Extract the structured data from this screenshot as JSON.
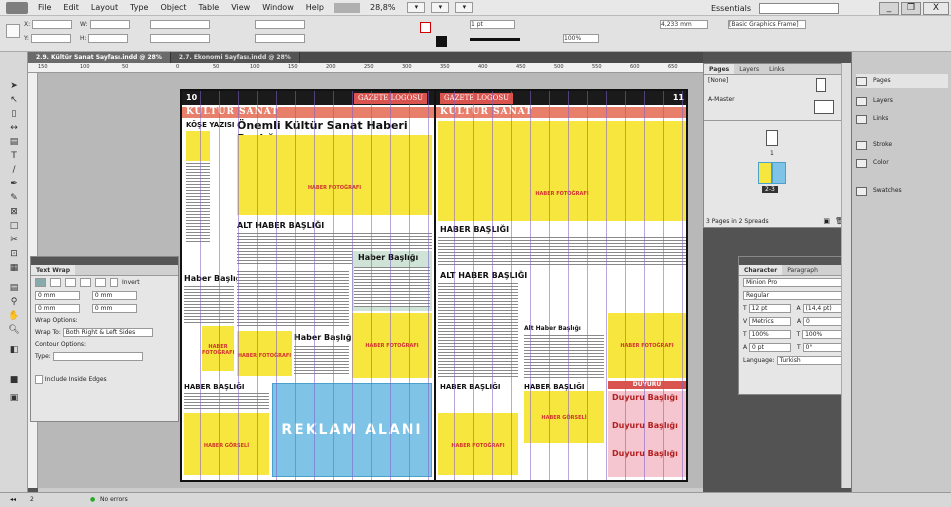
{
  "menu": {
    "items": [
      "File",
      "Edit",
      "Layout",
      "Type",
      "Object",
      "Table",
      "View",
      "Window",
      "Help"
    ],
    "zoom": "28,8%",
    "essentials": "Essentials",
    "window_controls": {
      "min": "_",
      "max": "❐",
      "close": "X"
    }
  },
  "control_bar": {
    "x_label": "X:",
    "y_label": "Y:",
    "w_label": "W:",
    "h_label": "H:",
    "stroke_weight": "1 pt",
    "percent": "100%",
    "measure": "4,233 mm",
    "frame_style": "[Basic Graphics Frame]"
  },
  "doc_tabs": [
    {
      "label": "2.9. Kültür Sanat Sayfası.indd @ 28%",
      "active": true
    },
    {
      "label": "2.7. Ekonomi Sayfası.indd @ 28%",
      "active": false
    }
  ],
  "ruler_ticks": [
    "150",
    "100",
    "50",
    "0",
    "50",
    "100",
    "150",
    "200",
    "250",
    "300",
    "350",
    "400",
    "450",
    "500",
    "550",
    "600",
    "650"
  ],
  "layout": {
    "page_left": {
      "number": "10",
      "logo": "GAZETE LOGOSU",
      "section": "KÜLTÜR SANAT",
      "column_label": "KÖŞE YAZISI",
      "main_headline": "Önemli Kültür Sanat Haberi Başlığı",
      "photo1": "HABER FOTOĞRAFI",
      "sub_headline": "ALT HABER BAŞLIĞI",
      "side_headline": "Haber Başlığı",
      "box_headline": "Haber Başlığı",
      "photo2": "HABER FOTOĞRAFI",
      "haber_headline": "Haber Başlığı",
      "photo3": "HABER FOTOĞRAFI",
      "small_headline": "HABER BAŞLIĞI",
      "gorsel": "HABER GÖRSELİ",
      "ad": "REKLAM ALANI",
      "foto_small": "HABER FOTOĞRAFI"
    },
    "page_right": {
      "number": "11",
      "logo": "GAZETE LOGOSU",
      "section": "KÜLTÜR SANAT",
      "photo1": "HABER FOTOĞRAFI",
      "headline1": "HABER BAŞLIĞI",
      "headline2": "ALT HABER BAŞLIĞI",
      "mid_headline": "Alt Haber Başlığı",
      "photo2": "HABER FOTOĞRAFI",
      "headline3": "HABER BAŞLIĞI",
      "headline4": "HABER BAŞLIĞI",
      "gorsel": "HABER GÖRSELİ",
      "photo3": "HABER FOTOĞRAFI",
      "duyuru_header": "DUYURU",
      "duyuru": [
        "Duyuru Başlığı",
        "Duyuru Başlığı",
        "Duyuru Başlığı"
      ]
    }
  },
  "text_wrap_panel": {
    "title": "Text Wrap",
    "invert": "Invert",
    "top": "0 mm",
    "bottom": "0 mm",
    "left": "0 mm",
    "right": "0 mm",
    "wrap_options": "Wrap Options:",
    "wrap_to_label": "Wrap To:",
    "wrap_to": "Both Right & Left Sides",
    "contour_options": "Contour Options:",
    "type_label": "Type:",
    "include_inside": "Include Inside Edges"
  },
  "pages_panel": {
    "tabs": [
      "Pages",
      "Layers",
      "Links"
    ],
    "none": "[None]",
    "master": "A-Master",
    "page_num": "1",
    "spread_label": "2-3",
    "footer": "3 Pages in 2 Spreads"
  },
  "character_panel": {
    "tabs": [
      "Character",
      "Paragraph"
    ],
    "font": "Minion Pro",
    "style": "Regular",
    "size": "12 pt",
    "leading": "(14,4 pt)",
    "kerning": "Metrics",
    "tracking": "0",
    "vscale": "100%",
    "hscale": "100%",
    "baseline": "0 pt",
    "skew": "0°",
    "language_label": "Language:",
    "language": "Turkish"
  },
  "side_panel": {
    "items": [
      "Pages",
      "Layers",
      "Links",
      "Stroke",
      "Color",
      "Swatches"
    ]
  },
  "status": {
    "page": "2",
    "errors": "No errors"
  }
}
